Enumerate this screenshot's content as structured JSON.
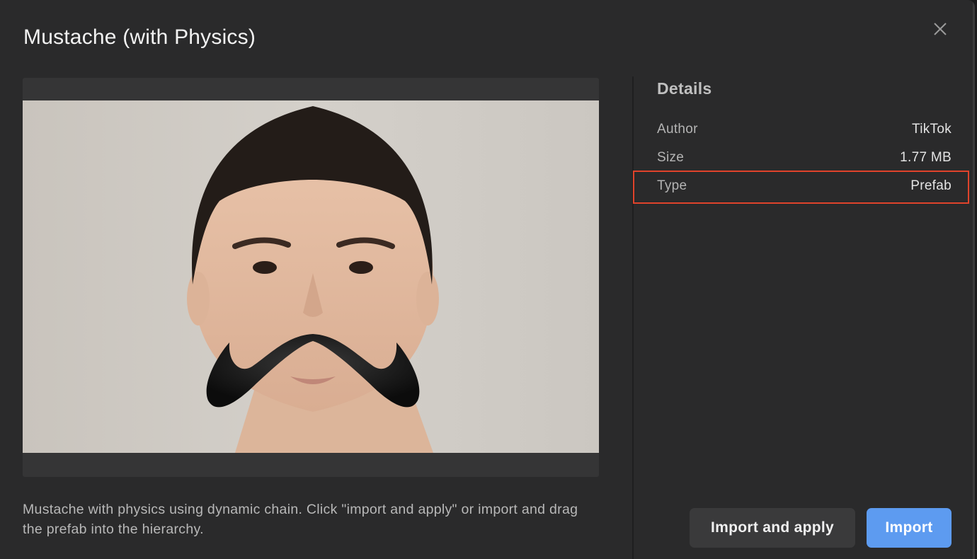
{
  "dialog": {
    "title": "Mustache (with Physics)",
    "close_icon": "close-icon",
    "description": "Mustache with physics using dynamic chain. Click \"import and apply\" or import and drag the prefab into the hierarchy."
  },
  "preview": {
    "alt": "Preview of a face wearing a black curled mustache"
  },
  "details": {
    "title": "Details",
    "rows": [
      {
        "key": "Author",
        "value": "TikTok"
      },
      {
        "key": "Size",
        "value": "1.77 MB"
      },
      {
        "key": "Type",
        "value": "Prefab"
      }
    ],
    "highlight_color": "#e0432b"
  },
  "actions": {
    "import_and_apply": "Import and apply",
    "import": "Import",
    "primary_color": "#5d9bf0"
  }
}
